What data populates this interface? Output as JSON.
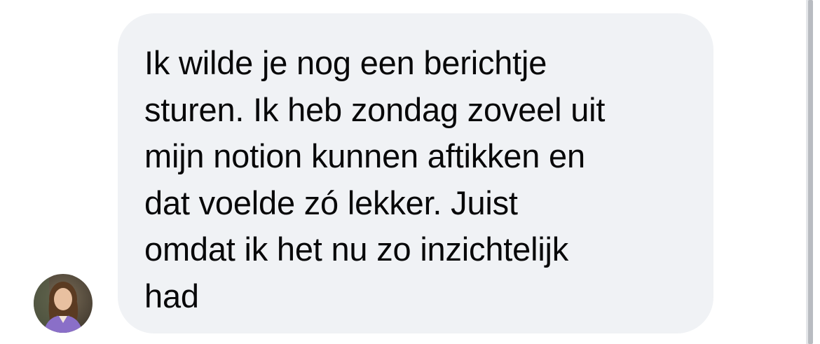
{
  "message": {
    "sender_avatar": "contact-avatar-photo",
    "lines": [
      "Ik wilde je nog een berichtje",
      "sturen. Ik heb zondag zoveel uit",
      "mijn notion kunnen aftikken en",
      "dat voelde zó lekker. Juist",
      "omdat ik het nu zo inzichtelijk",
      "had"
    ]
  },
  "colors": {
    "background": "#ffffff",
    "bubble": "#f0f2f5",
    "text": "#080809",
    "scrollbar": "#b9bcc1"
  }
}
